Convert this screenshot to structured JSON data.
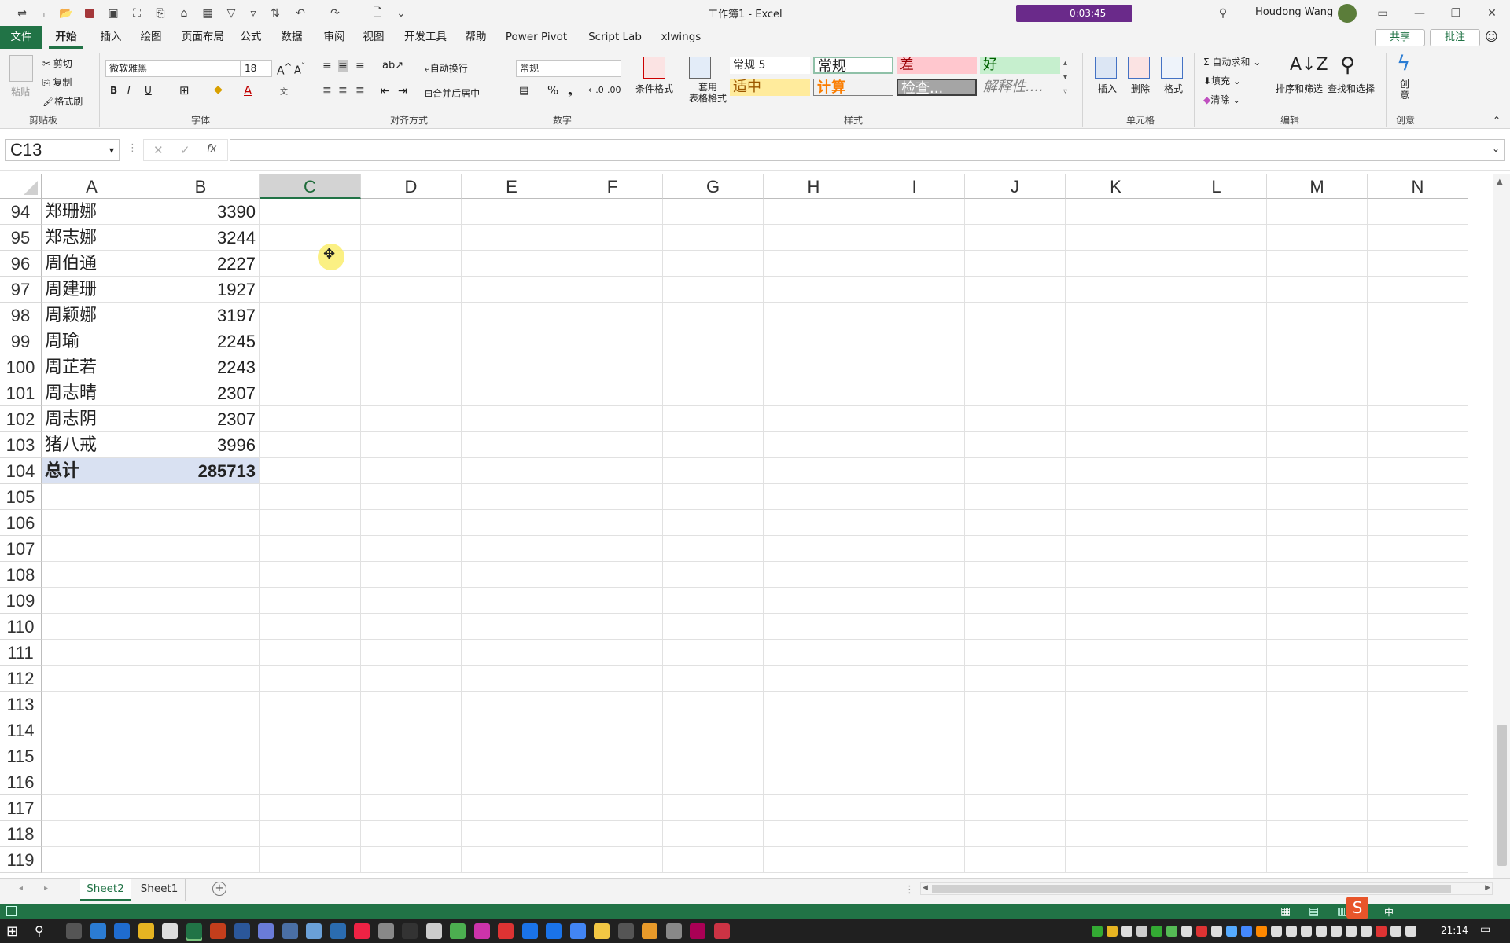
{
  "window": {
    "title": "工作簿1  -  Excel",
    "user": "Houdong Wang",
    "recording_time": "0:03:45"
  },
  "tabs": [
    "文件",
    "开始",
    "插入",
    "绘图",
    "页面布局",
    "公式",
    "数据",
    "审阅",
    "视图",
    "开发工具",
    "帮助",
    "Power Pivot",
    "Script Lab",
    "xlwings"
  ],
  "share_label": "共享",
  "comment_label": "批注",
  "ribbon": {
    "clipboard": {
      "paste": "粘贴",
      "cut": "剪切",
      "copy": "复制",
      "format_painter": "格式刷",
      "label": "剪贴板"
    },
    "font": {
      "name": "微软雅黑",
      "size": "18",
      "label": "字体"
    },
    "alignment": {
      "wrap": "自动换行",
      "merge": "合并后居中",
      "label": "对齐方式"
    },
    "number": {
      "format": "常规",
      "label": "数字"
    },
    "styles": {
      "conditional": "条件格式",
      "table": "套用\n表格格式",
      "label": "样式",
      "items": [
        "常规 5",
        "常规",
        "差",
        "好",
        "适中",
        "计算",
        "检查...",
        "解释性...."
      ]
    },
    "cells": {
      "insert": "插入",
      "delete": "删除",
      "format": "格式",
      "label": "单元格"
    },
    "editing": {
      "autosum": "自动求和",
      "fill": "填充",
      "clear": "清除",
      "sort": "排序和筛选",
      "find": "查找和选择",
      "label": "编辑"
    },
    "creative": {
      "label": "创意",
      "btn": "创\n意"
    }
  },
  "formula_bar": {
    "namebox": "C13",
    "fx": "fx",
    "content": ""
  },
  "columns": [
    "A",
    "B",
    "C",
    "D",
    "E",
    "F",
    "G",
    "H",
    "I",
    "J",
    "K",
    "L",
    "M",
    "N"
  ],
  "selected_column": "C",
  "rows": [
    {
      "n": "94",
      "a": "郑珊娜",
      "b": "3390"
    },
    {
      "n": "95",
      "a": "郑志娜",
      "b": "3244"
    },
    {
      "n": "96",
      "a": "周伯通",
      "b": "2227"
    },
    {
      "n": "97",
      "a": "周建珊",
      "b": "1927"
    },
    {
      "n": "98",
      "a": "周颖娜",
      "b": "3197"
    },
    {
      "n": "99",
      "a": "周瑜",
      "b": "2245"
    },
    {
      "n": "100",
      "a": "周芷若",
      "b": "2243"
    },
    {
      "n": "101",
      "a": "周志晴",
      "b": "2307"
    },
    {
      "n": "102",
      "a": "周志阴",
      "b": "2307"
    },
    {
      "n": "103",
      "a": "猪八戒",
      "b": "3996"
    },
    {
      "n": "104",
      "a": "总计",
      "b": "285713",
      "total": true
    },
    {
      "n": "105",
      "a": "",
      "b": ""
    },
    {
      "n": "106",
      "a": "",
      "b": ""
    },
    {
      "n": "107",
      "a": "",
      "b": ""
    },
    {
      "n": "108",
      "a": "",
      "b": ""
    },
    {
      "n": "109",
      "a": "",
      "b": ""
    },
    {
      "n": "110",
      "a": "",
      "b": ""
    },
    {
      "n": "111",
      "a": "",
      "b": ""
    },
    {
      "n": "112",
      "a": "",
      "b": ""
    },
    {
      "n": "113",
      "a": "",
      "b": ""
    },
    {
      "n": "114",
      "a": "",
      "b": ""
    },
    {
      "n": "115",
      "a": "",
      "b": ""
    },
    {
      "n": "116",
      "a": "",
      "b": ""
    },
    {
      "n": "117",
      "a": "",
      "b": ""
    },
    {
      "n": "118",
      "a": "",
      "b": ""
    },
    {
      "n": "119",
      "a": "",
      "b": ""
    }
  ],
  "sheets": [
    "Sheet2",
    "Sheet1"
  ],
  "active_sheet": "Sheet2",
  "taskbar": {
    "time": "21:14",
    "ime": "中"
  },
  "colors": {
    "excel_green": "#217346",
    "total_fill": "#d9e1f2"
  }
}
